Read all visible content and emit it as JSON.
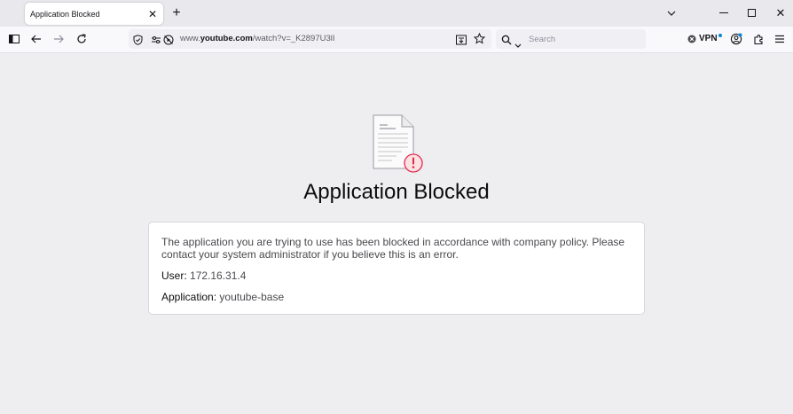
{
  "tab": {
    "title": "Application Blocked"
  },
  "navbar": {
    "url_prefix": "www.",
    "url_domain": "youtube.com",
    "url_path": "/watch?v=_K2897U3lI",
    "search_placeholder": "Search",
    "vpn_label": "VPN"
  },
  "page": {
    "heading": "Application Blocked",
    "message": "The application you are trying to use has been blocked in accordance with company policy. Please contact your system administrator if you believe this is an error.",
    "user_label": "User:",
    "user_value": "172.16.31.4",
    "app_label": "Application:",
    "app_value": "youtube-base"
  },
  "colors": {
    "warning_accent": "#e22850",
    "vpn_dot": "#0b84d8"
  }
}
